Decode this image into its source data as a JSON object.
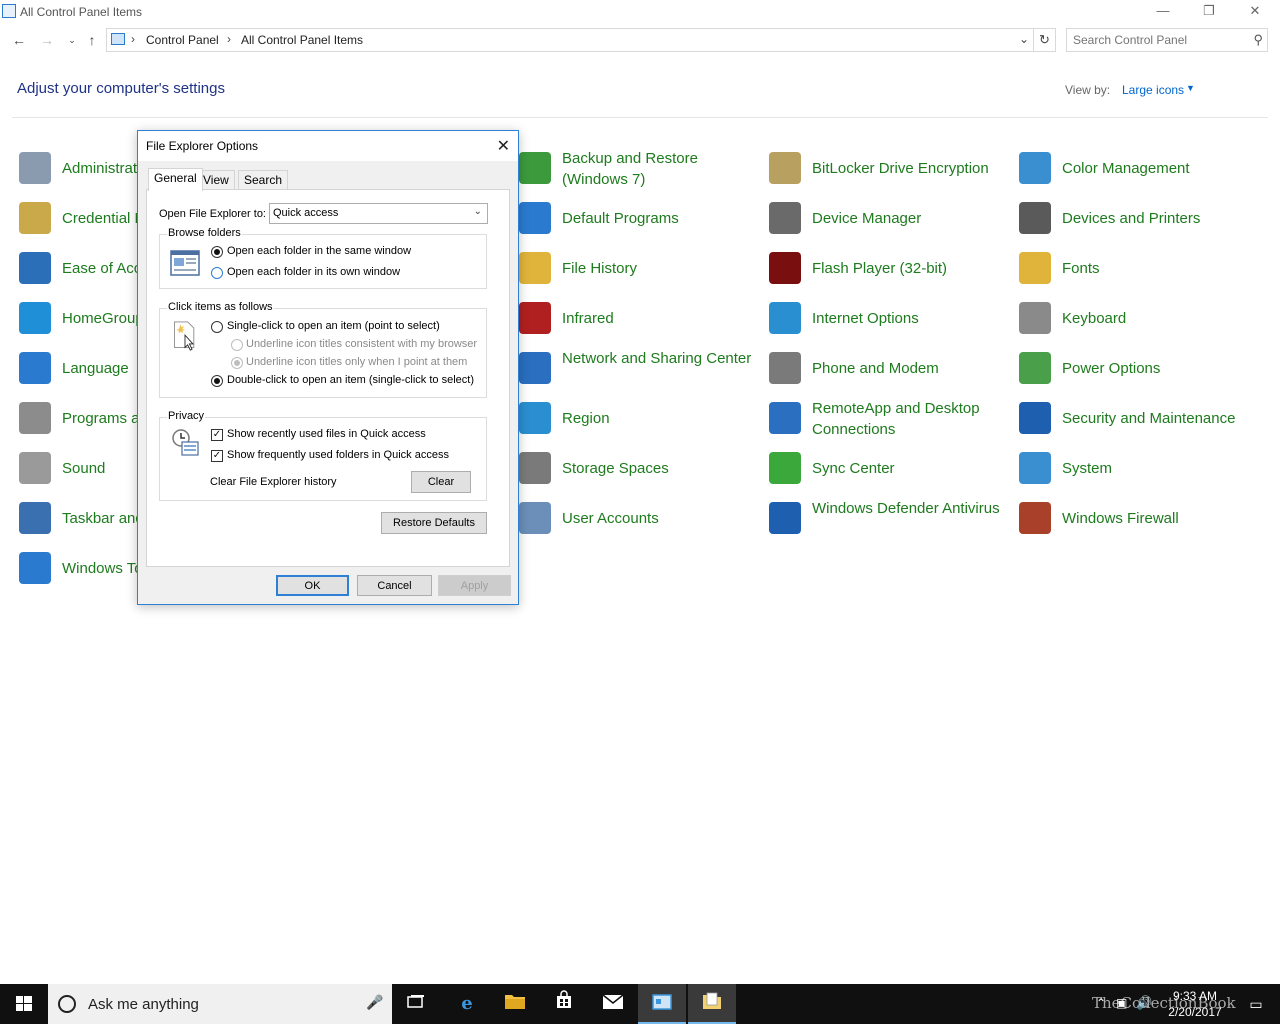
{
  "window": {
    "title": "All Control Panel Items",
    "minimize": "—",
    "restore": "❐",
    "close": "✕"
  },
  "address": {
    "crumbs": [
      "Control Panel",
      "All Control Panel Items"
    ],
    "search_placeholder": "Search Control Panel"
  },
  "main": {
    "heading": "Adjust your computer's settings",
    "view_by_label": "View by:",
    "view_by_value": "Large icons"
  },
  "items": {
    "c1": [
      "Administrative Tools",
      "Credential Manager",
      "Ease of Access Center",
      "HomeGroup",
      "Language",
      "Programs and Features",
      "Sound",
      "Taskbar and Navigation",
      "Windows To Go"
    ],
    "c2": [
      "Backup and Restore (Windows 7)",
      "Default Programs",
      "File History",
      "Infrared",
      "Network and Sharing Center",
      "Region",
      "Storage Spaces",
      "User Accounts"
    ],
    "c3": [
      "BitLocker Drive Encryption",
      "Device Manager",
      "Flash Player (32-bit)",
      "Internet Options",
      "Phone and Modem",
      "RemoteApp and Desktop Connections",
      "Sync Center",
      "Windows Defender Antivirus"
    ],
    "c4": [
      "Color Management",
      "Devices and Printers",
      "Fonts",
      "Keyboard",
      "Power Options",
      "Security and Maintenance",
      "System",
      "Windows Firewall"
    ]
  },
  "icon_names": {
    "c1": [
      "admin-tools-icon",
      "credential-icon",
      "ease-access-icon",
      "homegroup-icon",
      "language-icon",
      "programs-icon",
      "sound-icon",
      "taskbar-icon",
      "windows-to-go-icon"
    ],
    "c2": [
      "backup-icon",
      "default-programs-icon",
      "file-history-icon",
      "infrared-icon",
      "network-icon",
      "region-icon",
      "storage-icon",
      "user-accounts-icon"
    ],
    "c3": [
      "bitlocker-icon",
      "device-manager-icon",
      "flash-icon",
      "internet-options-icon",
      "phone-modem-icon",
      "remoteapp-icon",
      "sync-center-icon",
      "defender-icon"
    ],
    "c4": [
      "color-management-icon",
      "devices-printers-icon",
      "fonts-icon",
      "keyboard-icon",
      "power-options-icon",
      "security-maintenance-icon",
      "system-icon",
      "firewall-icon"
    ]
  },
  "icon_colors": {
    "c1": [
      "#8a9bb0",
      "#c9a94a",
      "#2b6fb8",
      "#1f8fd8",
      "#2a7bd0",
      "#8c8c8c",
      "#9a9a9a",
      "#3a6fb0",
      "#2a7bd0"
    ],
    "c2": [
      "#3c9a3c",
      "#2a7bd0",
      "#e0b43a",
      "#b02020",
      "#2a6fc0",
      "#2a8fd0",
      "#7a7a7a",
      "#6b8fb8"
    ],
    "c3": [
      "#b8a060",
      "#6a6a6a",
      "#7a0f0f",
      "#2a8fd0",
      "#7a7a7a",
      "#2a6fc0",
      "#3aa83a",
      "#1f5fb0"
    ],
    "c4": [
      "#3a8fd0",
      "#5a5a5a",
      "#e0b43a",
      "#8a8a8a",
      "#4aa04a",
      "#1f5fb0",
      "#3a8fd0",
      "#a8402a"
    ]
  },
  "dialog": {
    "title": "File Explorer Options",
    "tabs": [
      "General",
      "View",
      "Search"
    ],
    "open_to_label": "Open File Explorer to:",
    "open_to_value": "Quick access",
    "browse_group": "Browse folders",
    "browse_same": "Open each folder in the same window",
    "browse_own": "Open each folder in its own window",
    "click_group": "Click items as follows",
    "single_click": "Single-click to open an item (point to select)",
    "underline_browser": "Underline icon titles consistent with my browser",
    "underline_point": "Underline icon titles only when I point at them",
    "double_click": "Double-click to open an item (single-click to select)",
    "privacy_group": "Privacy",
    "recent_files": "Show recently used files in Quick access",
    "frequent_folders": "Show frequently used folders in Quick access",
    "clear_history_label": "Clear File Explorer history",
    "clear_btn": "Clear",
    "restore_btn": "Restore Defaults",
    "ok_btn": "OK",
    "cancel_btn": "Cancel",
    "apply_btn": "Apply"
  },
  "taskbar": {
    "search_text": "Ask me anything",
    "time": "9:33 AM",
    "date": "2/20/2017",
    "watermark": "TheCollectionBook"
  }
}
